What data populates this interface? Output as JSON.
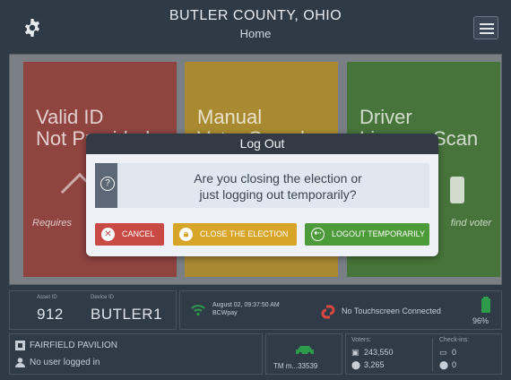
{
  "header": {
    "title": "BUTLER COUNTY, OHIO",
    "subtitle": "Home",
    "settings_icon": "gear-icon",
    "menu_icon": "hamburger-icon"
  },
  "tiles": [
    {
      "label_line1": "Valid ID",
      "label_line2": "Not Provided",
      "footer": "Requires",
      "color": "#8f4440"
    },
    {
      "label_line1": "Manual",
      "label_line2": "Voter Search",
      "footer": "",
      "color": "#a98a31"
    },
    {
      "label_line1": "Driver",
      "label_line2": "License Scan",
      "footer": "find voter",
      "color": "#47743a"
    }
  ],
  "modal": {
    "title": "Log Out",
    "message_line1": "Are you closing the election or",
    "message_line2": "just logging out temporarily?",
    "cancel_label": "CANCEL",
    "close_label": "CLOSE THE ELECTION",
    "logout_label": "LOGOUT TEMPORARILY",
    "colors": {
      "cancel": "#c94a44",
      "close": "#d7a629",
      "logout": "#4d9a3a"
    }
  },
  "status": {
    "asset_caption": "Asset ID",
    "asset_id": "912",
    "device_caption": "Device ID",
    "device_id": "BUTLER1",
    "datetime": "August 02, 09:37:50 AM",
    "network": "BCWpay",
    "touchscreen_text": "No Touchscreen Connected",
    "battery": "96%",
    "location": "FAIRFIELD PAVILION",
    "user_status": "No user logged in",
    "tm_text": "TM m...33539",
    "voters_caption": "Voters:",
    "voters_registered": "243,550",
    "voters_count": "3,265",
    "checkins_caption": "Check-ins:",
    "checkins_a": "0",
    "checkins_b": "0"
  }
}
